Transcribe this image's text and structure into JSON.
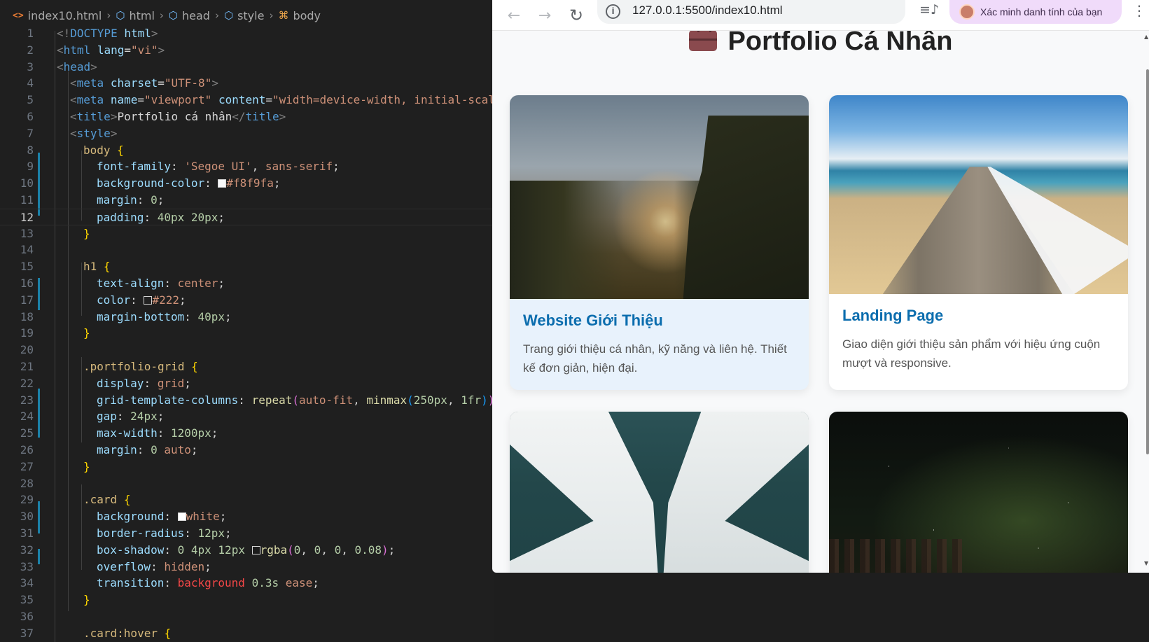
{
  "editor": {
    "breadcrumb": [
      "index10.html",
      "html",
      "head",
      "style",
      "body"
    ],
    "active_line": 12,
    "code_lines": [
      {
        "n": "1",
        "indent": 0,
        "html": "<span style='color:#808080'>&lt;!</span><span style='color:#569cd6'>DOCTYPE</span> <span style='color:#9cdcfe'>html</span><span style='color:#808080'>&gt;</span>"
      },
      {
        "n": "2",
        "indent": 0,
        "html": "<span style='color:#808080'>&lt;</span><span style='color:#569cd6'>html</span> <span style='color:#9cdcfe'>lang</span>=<span style='color:#ce9178'>\"vi\"</span><span style='color:#808080'>&gt;</span>"
      },
      {
        "n": "3",
        "indent": 0,
        "html": "<span style='color:#808080'>&lt;</span><span style='color:#569cd6'>head</span><span style='color:#808080'>&gt;</span>"
      },
      {
        "n": "4",
        "indent": 1,
        "html": "<span style='color:#808080'>&lt;</span><span style='color:#569cd6'>meta</span> <span style='color:#9cdcfe'>charset</span>=<span style='color:#ce9178'>\"UTF-8\"</span><span style='color:#808080'>&gt;</span>"
      },
      {
        "n": "5",
        "indent": 1,
        "html": "<span style='color:#808080'>&lt;</span><span style='color:#569cd6'>meta</span> <span style='color:#9cdcfe'>name</span>=<span style='color:#ce9178'>\"viewport\"</span> <span style='color:#9cdcfe'>content</span>=<span style='color:#ce9178'>\"width=device-width, initial-scal</span>"
      },
      {
        "n": "6",
        "indent": 1,
        "html": "<span style='color:#808080'>&lt;</span><span style='color:#569cd6'>title</span><span style='color:#808080'>&gt;</span>Portfolio cá nhân<span style='color:#808080'>&lt;/</span><span style='color:#569cd6'>title</span><span style='color:#808080'>&gt;</span>"
      },
      {
        "n": "7",
        "indent": 1,
        "html": "<span style='color:#808080'>&lt;</span><span style='color:#569cd6'>style</span><span style='color:#808080'>&gt;</span>"
      },
      {
        "n": "8",
        "indent": 2,
        "html": "<span style='color:#d7ba7d'>body</span> <span style='color:#ffd700'>{</span>"
      },
      {
        "n": "9",
        "indent": 3,
        "html": "<span style='color:#9cdcfe'>font-family</span>: <span style='color:#ce9178'>'Segoe UI'</span>, <span style='color:#ce9178'>sans-serif</span>;"
      },
      {
        "n": "10",
        "indent": 3,
        "html": "<span style='color:#9cdcfe'>background-color</span>: <span style='display:inline-block;width:12px;height:12px;background:#f8f9fa;border:1px solid #d4d4d4;vertical-align:-1px'></span><span style='color:#ce9178'>#f8f9fa</span>;"
      },
      {
        "n": "11",
        "indent": 3,
        "html": "<span style='color:#9cdcfe'>margin</span>: <span style='color:#b5cea8'>0</span>;"
      },
      {
        "n": "12",
        "indent": 3,
        "html": "<span style='color:#9cdcfe'>padding</span>: <span style='color:#b5cea8'>40px</span> <span style='color:#b5cea8'>20px</span>;"
      },
      {
        "n": "13",
        "indent": 2,
        "html": "<span style='color:#ffd700'>}</span>"
      },
      {
        "n": "14",
        "indent": 0,
        "html": ""
      },
      {
        "n": "15",
        "indent": 2,
        "html": "<span style='color:#d7ba7d'>h1</span> <span style='color:#ffd700'>{</span>"
      },
      {
        "n": "16",
        "indent": 3,
        "html": "<span style='color:#9cdcfe'>text-align</span>: <span style='color:#ce9178'>center</span>;"
      },
      {
        "n": "17",
        "indent": 3,
        "html": "<span style='color:#9cdcfe'>color</span>: <span style='display:inline-block;width:12px;height:12px;background:#222;border:1px solid #d4d4d4;vertical-align:-1px'></span><span style='color:#ce9178'>#222</span>;"
      },
      {
        "n": "18",
        "indent": 3,
        "html": "<span style='color:#9cdcfe'>margin-bottom</span>: <span style='color:#b5cea8'>40px</span>;"
      },
      {
        "n": "19",
        "indent": 2,
        "html": "<span style='color:#ffd700'>}</span>"
      },
      {
        "n": "20",
        "indent": 0,
        "html": ""
      },
      {
        "n": "21",
        "indent": 2,
        "html": "<span style='color:#d7ba7d'>.portfolio-grid</span> <span style='color:#ffd700'>{</span>"
      },
      {
        "n": "22",
        "indent": 3,
        "html": "<span style='color:#9cdcfe'>display</span>: <span style='color:#ce9178'>grid</span>;"
      },
      {
        "n": "23",
        "indent": 3,
        "html": "<span style='color:#9cdcfe'>grid-template-columns</span>: <span style='color:#dcdcaa'>repeat</span><span style='color:#da70d6'>(</span><span style='color:#ce9178'>auto-fit</span>, <span style='color:#dcdcaa'>minmax</span><span style='color:#179fff'>(</span><span style='color:#b5cea8'>250px</span>, <span style='color:#b5cea8'>1fr</span><span style='color:#179fff'>)</span><span style='color:#da70d6'>)</span>"
      },
      {
        "n": "24",
        "indent": 3,
        "html": "<span style='color:#9cdcfe'>gap</span>: <span style='color:#b5cea8'>24px</span>;"
      },
      {
        "n": "25",
        "indent": 3,
        "html": "<span style='color:#9cdcfe'>max-width</span>: <span style='color:#b5cea8'>1200px</span>;"
      },
      {
        "n": "26",
        "indent": 3,
        "html": "<span style='color:#9cdcfe'>margin</span>: <span style='color:#b5cea8'>0</span> <span style='color:#ce9178'>auto</span>;"
      },
      {
        "n": "27",
        "indent": 2,
        "html": "<span style='color:#ffd700'>}</span>"
      },
      {
        "n": "28",
        "indent": 0,
        "html": ""
      },
      {
        "n": "29",
        "indent": 2,
        "html": "<span style='color:#d7ba7d'>.card</span> <span style='color:#ffd700'>{</span>"
      },
      {
        "n": "30",
        "indent": 3,
        "html": "<span style='color:#9cdcfe'>background</span>: <span style='display:inline-block;width:12px;height:12px;background:#fff;border:1px solid #d4d4d4;vertical-align:-1px'></span><span style='color:#ce9178'>white</span>;"
      },
      {
        "n": "31",
        "indent": 3,
        "html": "<span style='color:#9cdcfe'>border-radius</span>: <span style='color:#b5cea8'>12px</span>;"
      },
      {
        "n": "32",
        "indent": 3,
        "html": "<span style='color:#9cdcfe'>box-shadow</span>: <span style='color:#b5cea8'>0</span> <span style='color:#b5cea8'>4px</span> <span style='color:#b5cea8'>12px</span> <span style='display:inline-block;width:12px;height:12px;background:rgba(0,0,0,0.08);border:1px solid #d4d4d4;vertical-align:-1px'></span><span style='color:#dcdcaa'>rgba</span><span style='color:#da70d6'>(</span><span style='color:#b5cea8'>0</span>, <span style='color:#b5cea8'>0</span>, <span style='color:#b5cea8'>0</span>, <span style='color:#b5cea8'>0.08</span><span style='color:#da70d6'>)</span>;"
      },
      {
        "n": "33",
        "indent": 3,
        "html": "<span style='color:#9cdcfe'>overflow</span>: <span style='color:#ce9178'>hidden</span>;"
      },
      {
        "n": "34",
        "indent": 3,
        "html": "<span style='color:#9cdcfe'>transition</span>: <span style='color:#f44747'>background</span> <span style='color:#b5cea8'>0.3s</span> <span style='color:#ce9178'>ease</span>;"
      },
      {
        "n": "35",
        "indent": 2,
        "html": "<span style='color:#ffd700'>}</span>"
      },
      {
        "n": "36",
        "indent": 0,
        "html": ""
      },
      {
        "n": "37",
        "indent": 2,
        "html": "<span style='color:#d7ba7d'>.card:hover</span> <span style='color:#ffd700'>{</span>"
      }
    ]
  },
  "browser": {
    "url": "127.0.0.1:5500/index10.html",
    "profile_label": "Xác minh danh tính của bạn",
    "page": {
      "heading": "Portfolio Cá Nhân",
      "cards": [
        {
          "title": "Website Giới Thiệu",
          "description": "Trang giới thiệu cá nhân, kỹ năng và liên hệ. Thiết kế đơn giản, hiện đại."
        },
        {
          "title": "Landing Page",
          "description": "Giao diện giới thiệu sản phẩm với hiệu ứng cuộn mượt và responsive."
        },
        {
          "title": "",
          "description": ""
        },
        {
          "title": "",
          "description": ""
        }
      ]
    }
  }
}
